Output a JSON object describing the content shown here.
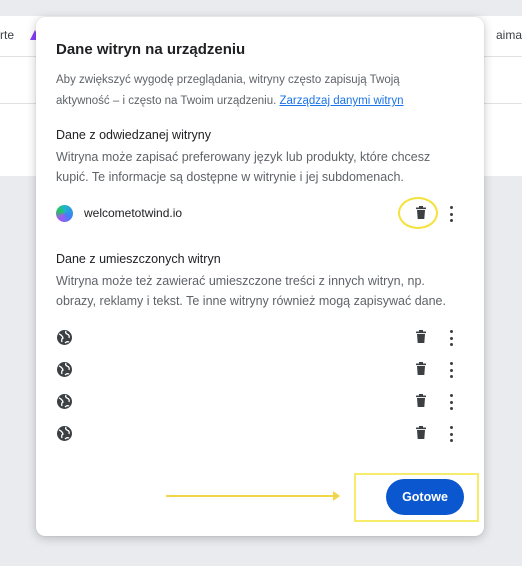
{
  "background": {
    "tab_left_text": "rte",
    "tab_right_text": "aima"
  },
  "dialog": {
    "title": "Dane witryn na urządzeniu",
    "intro_text": "Aby zwiększyć wygodę przeglądania, witryny często zapisują Twoją aktywność – i często na Twoim urządzeniu.",
    "manage_link": "Zarządzaj danymi witryn",
    "visited_section": {
      "title": "Dane z odwiedzanej witryny",
      "description": "Witryna może zapisać preferowany język lub produkty, które chcesz kupić. Te informacje są dostępne w witrynie i jej subdomenach.",
      "site": {
        "name": "welcometotwind.io",
        "icon": "site-favicon"
      }
    },
    "embedded_section": {
      "title": "Dane z umieszczonych witryn",
      "description": "Witryna może też zawierać umieszczone treści z innych witryn, np. obrazy, reklamy i tekst. Te inne witryny również mogą zapisywać dane.",
      "sites": [
        {
          "name": "",
          "icon": "globe-icon"
        },
        {
          "name": "",
          "icon": "globe-icon"
        },
        {
          "name": "",
          "icon": "globe-icon"
        },
        {
          "name": "",
          "icon": "globe-icon"
        }
      ]
    },
    "done_button": "Gotowe"
  },
  "colors": {
    "accent": "#0b57d0",
    "link": "#1a73e8",
    "highlight": "#f4e23a"
  }
}
